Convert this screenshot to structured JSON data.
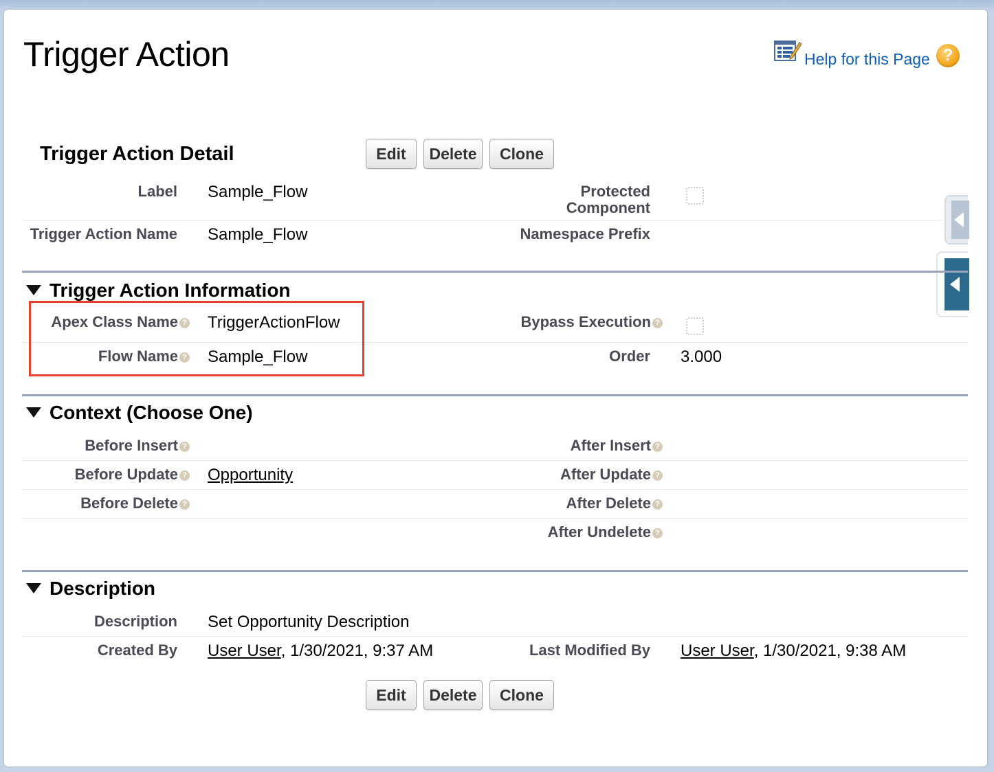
{
  "page": {
    "title": "Trigger Action",
    "help_label": "Help for this Page",
    "help_q": "?"
  },
  "detail": {
    "heading": "Trigger Action Detail",
    "buttons": {
      "edit": "Edit",
      "delete": "Delete",
      "clone": "Clone"
    },
    "fields": {
      "label_lbl": "Label",
      "label_val": "Sample_Flow",
      "protected_lbl_1": "Protected",
      "protected_lbl_2": "Component",
      "protected_checked": false,
      "name_lbl": "Trigger Action Name",
      "name_val": "Sample_Flow",
      "namespace_lbl": "Namespace Prefix",
      "namespace_val": ""
    }
  },
  "info": {
    "heading": "Trigger Action Information",
    "apex_lbl": "Apex Class Name",
    "apex_val": "TriggerActionFlow",
    "bypass_lbl": "Bypass Execution",
    "bypass_checked": false,
    "flow_lbl": "Flow Name",
    "flow_val": "Sample_Flow",
    "order_lbl": "Order",
    "order_val": "3.000"
  },
  "context": {
    "heading": "Context (Choose One)",
    "before_insert_lbl": "Before Insert",
    "after_insert_lbl": "After Insert",
    "before_update_lbl": "Before Update",
    "before_update_val": "Opportunity",
    "after_update_lbl": "After Update",
    "before_delete_lbl": "Before Delete",
    "after_delete_lbl": "After Delete",
    "after_undelete_lbl": "After Undelete"
  },
  "description": {
    "heading": "Description",
    "desc_lbl": "Description",
    "desc_val": "Set Opportunity Description",
    "created_lbl": "Created By",
    "created_user": "User User",
    "created_ts": ", 1/30/2021, 9:37 AM",
    "modified_lbl": "Last Modified By",
    "modified_user": "User User",
    "modified_ts": ", 1/30/2021, 9:38 AM"
  },
  "footer_buttons": {
    "edit": "Edit",
    "delete": "Delete",
    "clone": "Clone"
  },
  "colors": {
    "link_blue": "#0f5fb4",
    "highlight_red": "#e5412e",
    "section_rule": "#98a3bd",
    "label_gray": "#4a4a56"
  }
}
